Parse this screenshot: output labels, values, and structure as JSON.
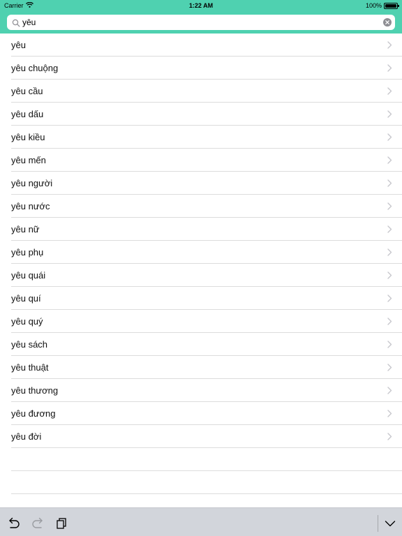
{
  "status_bar": {
    "carrier": "Carrier",
    "time": "1:22 AM",
    "battery": "100%",
    "battery_level": 1.0
  },
  "search": {
    "value": "yêu"
  },
  "results": [
    "yêu",
    "yêu chuộng",
    "yêu cầu",
    "yêu dấu",
    "yêu kiều",
    "yêu mến",
    "yêu người",
    "yêu nước",
    "yêu nữ",
    "yêu phụ",
    "yêu quái",
    "yêu quí",
    "yêu quý",
    "yêu sách",
    "yêu thuật",
    "yêu thương",
    "yêu đương",
    "yêu đời"
  ],
  "toolbar": {
    "icons": [
      "undo-icon",
      "redo-icon",
      "paste-icon",
      "chevron-down-icon"
    ]
  },
  "colors": {
    "header": "#4fd1b0",
    "toolbar": "#d2d5db",
    "separator": "#dcdcdc",
    "chevron": "#c7c7cc"
  }
}
